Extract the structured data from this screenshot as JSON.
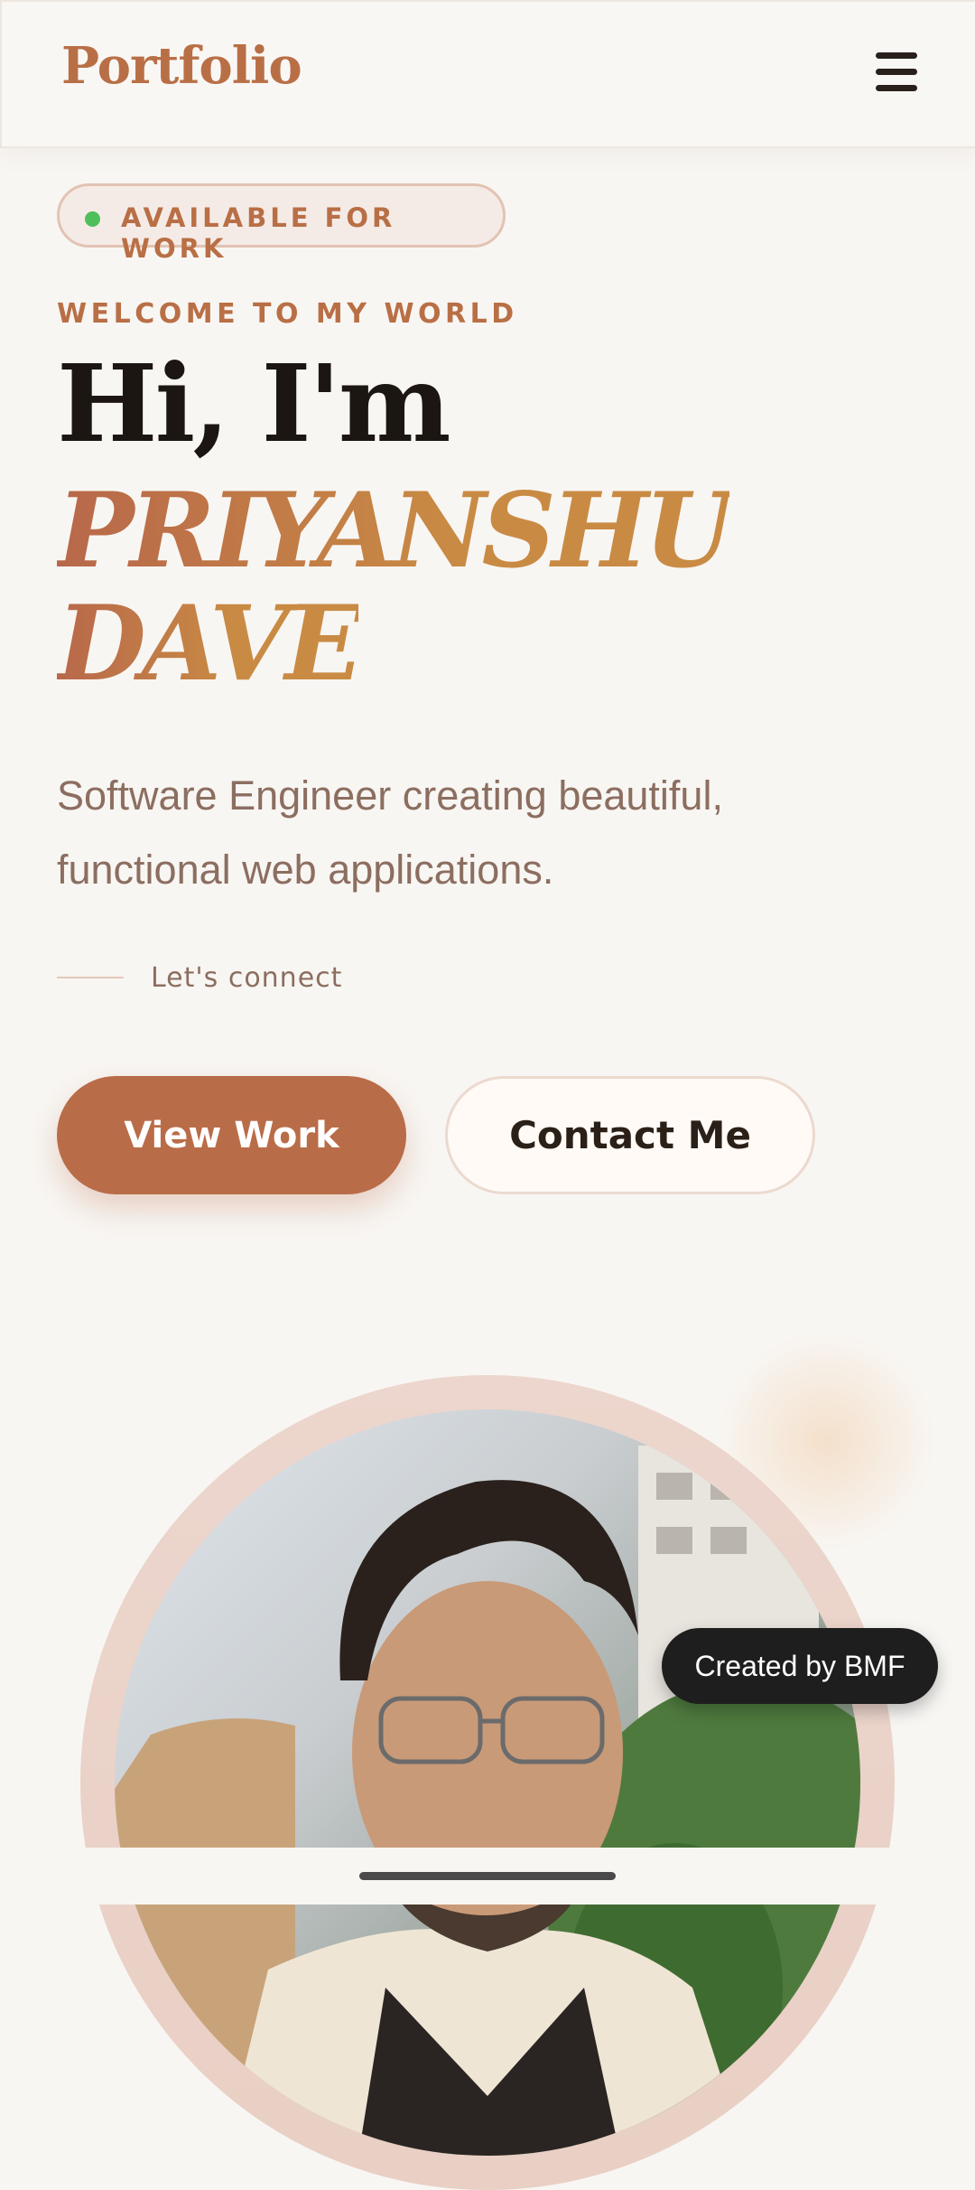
{
  "header": {
    "logo": "Portfolio",
    "menu_icon": "hamburger-menu-icon"
  },
  "hero": {
    "badge": "AVAILABLE FOR WORK",
    "welcome": "WELCOME TO MY WORLD",
    "greeting": "Hi, I'm",
    "name_line1": "PRIYANSHU",
    "name_line2": "DAVE",
    "tagline": "Software Engineer creating beautiful, functional web applications.",
    "connect_label": "Let's connect",
    "primary_button": "View Work",
    "secondary_button": "Contact Me"
  },
  "credit": {
    "label": "Created by BMF"
  },
  "colors": {
    "accent": "#b96c48",
    "gold": "#c98b44",
    "status_green": "#4fbf5c",
    "text_dark": "#1c1612"
  }
}
